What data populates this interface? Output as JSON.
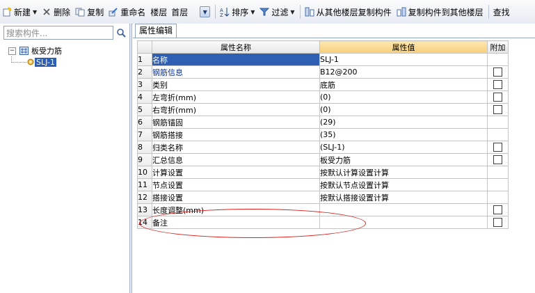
{
  "toolbar": {
    "new_label": "新建",
    "delete_label": "删除",
    "copy_label": "复制",
    "rename_label": "重命名",
    "floor_label": "楼层",
    "floor_value": "首层",
    "sort_label": "排序",
    "filter_label": "过滤",
    "copy_from_label": "从其他楼层复制构件",
    "copy_to_label": "复制构件到其他楼层",
    "find_label": "查找"
  },
  "left": {
    "search_placeholder": "搜索构件...",
    "tree_root": "板受力筋",
    "tree_child": "SLJ-1"
  },
  "right": {
    "tab_label": "属性编辑",
    "columns": [
      "属性名称",
      "属性值",
      "附加"
    ],
    "rows": [
      {
        "num": "1",
        "name": "名称",
        "value": "SLJ-1",
        "checkbox": false,
        "blue": false
      },
      {
        "num": "2",
        "name": "钢筋信息",
        "value": "B12@200",
        "checkbox": true,
        "blue": true
      },
      {
        "num": "3",
        "name": "类别",
        "value": "底筋",
        "checkbox": true,
        "blue": false
      },
      {
        "num": "4",
        "name": "左弯折(mm)",
        "value": "(0)",
        "checkbox": true,
        "blue": false
      },
      {
        "num": "5",
        "name": "右弯折(mm)",
        "value": "(0)",
        "checkbox": true,
        "blue": false
      },
      {
        "num": "6",
        "name": "钢筋锚固",
        "value": "(29)",
        "checkbox": false,
        "blue": false
      },
      {
        "num": "7",
        "name": "钢筋搭接",
        "value": "(35)",
        "checkbox": false,
        "blue": false
      },
      {
        "num": "8",
        "name": "归类名称",
        "value": "(SLJ-1)",
        "checkbox": true,
        "blue": false
      },
      {
        "num": "9",
        "name": "汇总信息",
        "value": "板受力筋",
        "checkbox": true,
        "blue": false
      },
      {
        "num": "10",
        "name": "计算设置",
        "value": "按默认计算设置计算",
        "checkbox": false,
        "blue": false
      },
      {
        "num": "11",
        "name": "节点设置",
        "value": "按默认节点设置计算",
        "checkbox": false,
        "blue": false
      },
      {
        "num": "12",
        "name": "搭接设置",
        "value": "按默认搭接设置计算",
        "checkbox": false,
        "blue": false
      },
      {
        "num": "13",
        "name": "长度调整(mm)",
        "value": "",
        "checkbox": true,
        "blue": false
      },
      {
        "num": "14",
        "name": "备注",
        "value": "",
        "checkbox": true,
        "blue": false
      }
    ]
  },
  "colors": {
    "accent": "#2e5fb3",
    "header_highlight": "#f7cf7c",
    "annotation": "#d9201b",
    "blue_text": "#0a2e95"
  }
}
